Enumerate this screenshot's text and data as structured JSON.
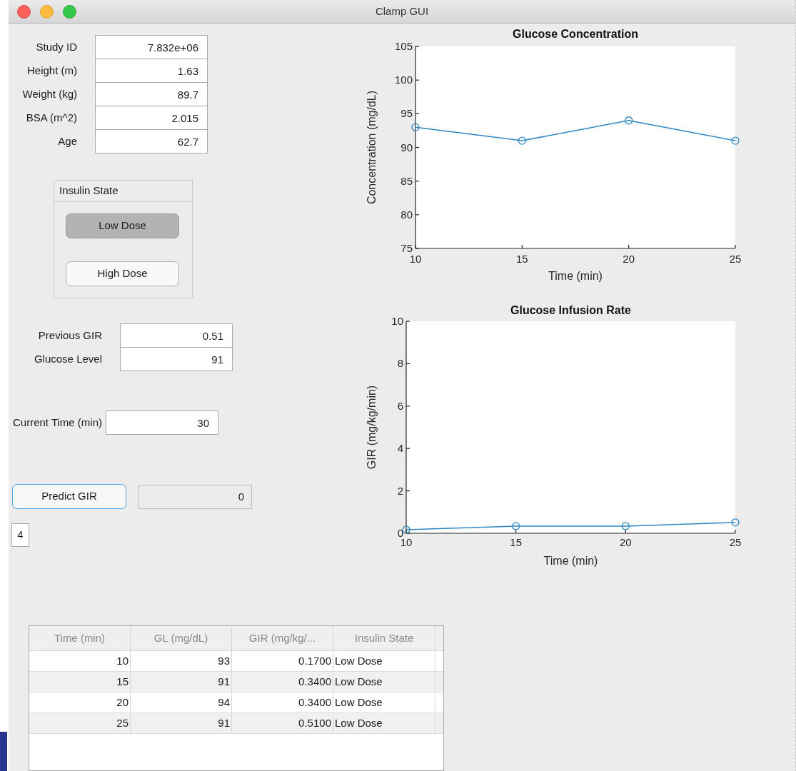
{
  "window": {
    "title": "Clamp GUI"
  },
  "patient_fields": [
    {
      "label": "Study ID",
      "value": "7.832e+06"
    },
    {
      "label": "Height (m)",
      "value": "1.63"
    },
    {
      "label": "Weight (kg)",
      "value": "89.7"
    },
    {
      "label": "BSA (m^2)",
      "value": "2.015"
    },
    {
      "label": "Age",
      "value": "62.7"
    }
  ],
  "insulin_state": {
    "title": "Insulin State",
    "options": [
      {
        "label": "Low Dose",
        "selected": true
      },
      {
        "label": "High Dose",
        "selected": false
      }
    ]
  },
  "inputs": [
    {
      "label": "Previous GIR",
      "value": "0.51"
    },
    {
      "label": "Glucose Level",
      "value": "91"
    }
  ],
  "current_time": {
    "label": "Current Time (min)",
    "value": "30"
  },
  "predict": {
    "button": "Predict GIR",
    "output": "0"
  },
  "counter": "4",
  "charts": [
    {
      "chart_data": {
        "type": "line",
        "title": "Glucose Concentration",
        "xlabel": "Time (min)",
        "ylabel": "Concentration (mg/dL)",
        "x": [
          10,
          15,
          20,
          25
        ],
        "xlim": [
          10,
          25
        ],
        "ylim": [
          75,
          105
        ],
        "xticks": [
          10,
          15,
          20,
          25
        ],
        "yticks": [
          75,
          80,
          85,
          90,
          95,
          100,
          105
        ],
        "series": [
          {
            "color": "#2f86c4",
            "marker": "circle",
            "values": [
              93,
              91,
              94,
              91
            ]
          }
        ]
      }
    },
    {
      "chart_data": {
        "type": "line",
        "title": "Glucose Infusion Rate",
        "xlabel": "Time (min)",
        "ylabel": "GIR (mg/kg/min)",
        "x": [
          10,
          15,
          20,
          25
        ],
        "xlim": [
          10,
          25
        ],
        "ylim": [
          0,
          10
        ],
        "xticks": [
          10,
          15,
          20,
          25
        ],
        "yticks": [
          0,
          2,
          4,
          6,
          8,
          10
        ],
        "series": [
          {
            "color": "#2f86c4",
            "marker": "circle",
            "values": [
              0.17,
              0.34,
              0.34,
              0.51
            ]
          }
        ]
      }
    }
  ],
  "table": {
    "columns": [
      "Time (min)",
      "GL (mg/dL)",
      "GIR (mg/kg/...",
      "Insulin State"
    ],
    "rows": [
      [
        "10",
        "93",
        "0.1700",
        "Low Dose"
      ],
      [
        "15",
        "91",
        "0.3400",
        "Low Dose"
      ],
      [
        "20",
        "94",
        "0.3400",
        "Low Dose"
      ],
      [
        "25",
        "91",
        "0.5100",
        "Low Dose"
      ]
    ]
  }
}
